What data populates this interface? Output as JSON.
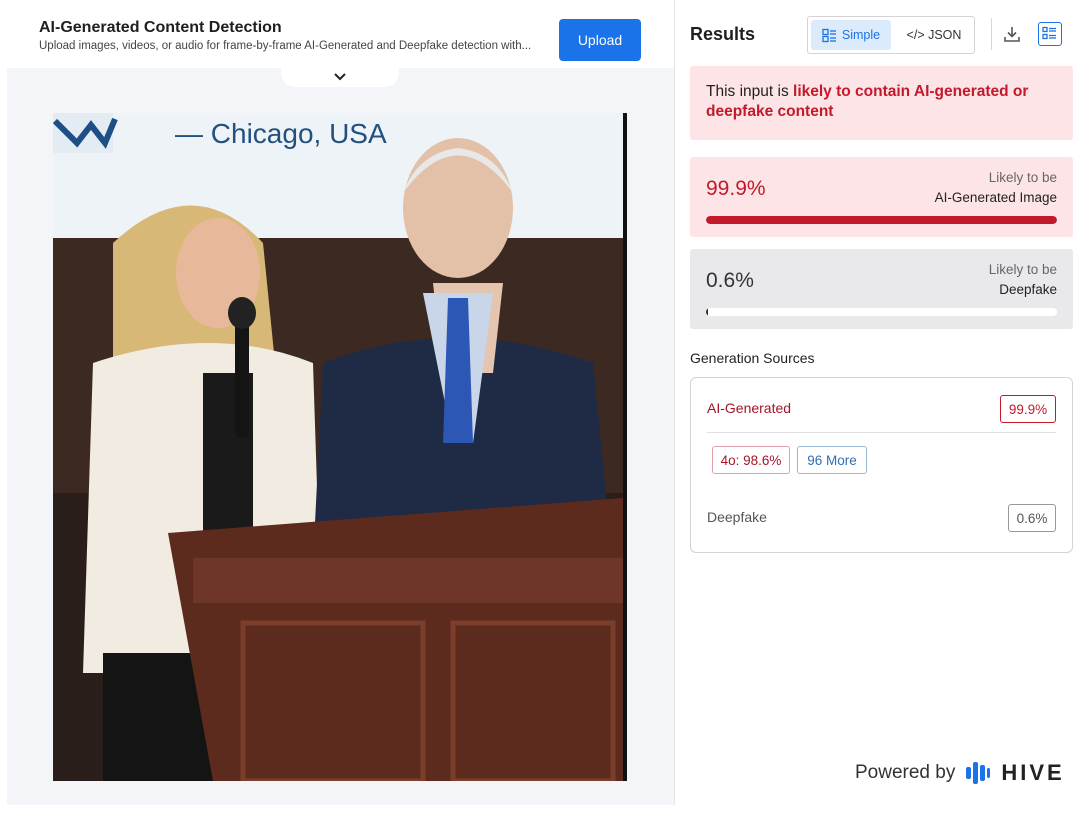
{
  "app": {
    "title": "AI-Generated Content Detection",
    "subtitle": "Upload images, videos, or audio for frame-by-frame AI-Generated and Deepfake detection with...",
    "upload_label": "Upload"
  },
  "photo": {
    "banner_text": "— Chicago, USA"
  },
  "results": {
    "title": "Results",
    "toggle": {
      "simple_label": "Simple",
      "json_label": "</> JSON",
      "active": "Simple"
    },
    "verdict_prefix": "This input is ",
    "verdict_highlight": "likely to contain AI-generated or deepfake content",
    "scores": [
      {
        "value_text": "99.9%",
        "value": 0.999,
        "likely_label": "Likely to be",
        "target": "AI-Generated Image"
      },
      {
        "value_text": "0.6%",
        "value": 0.006,
        "likely_label": "Likely to be",
        "target": "Deepfake"
      }
    ],
    "generation_sources": {
      "title": "Generation Sources",
      "ai_label": "AI-Generated",
      "ai_score": "99.9%",
      "top_source": "4o: 98.6%",
      "more": "96 More",
      "deepfake_label": "Deepfake",
      "deepfake_score": "0.6%"
    }
  },
  "footer": {
    "powered_by": "Powered by",
    "brand": "HIVE"
  },
  "colors": {
    "accent_blue": "#1a73e8",
    "alert_red": "#c21a2b",
    "alert_bg": "#fde4e6"
  }
}
